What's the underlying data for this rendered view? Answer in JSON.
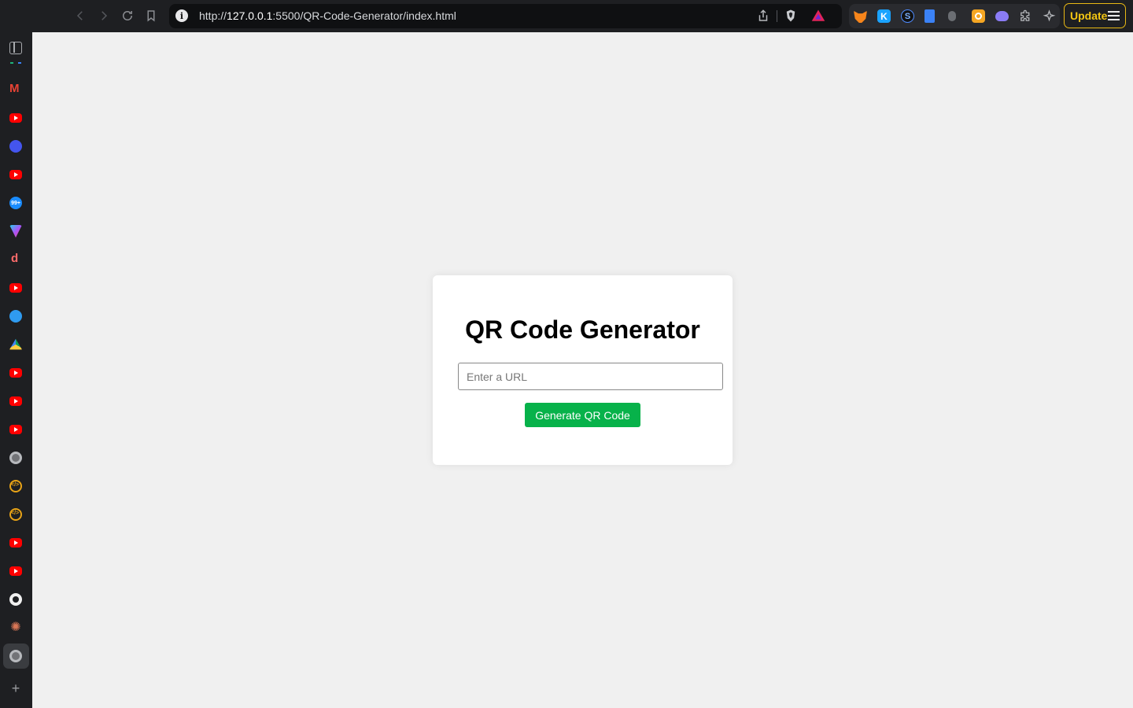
{
  "browser": {
    "url_scheme": "http://",
    "url_host": "127.0.0.1",
    "url_rest": ":5500/QR-Code-Generator/index.html",
    "update_label": "Update",
    "extensions": [
      "metamask-icon",
      "k-extension-icon",
      "s-extension-icon",
      "document-extension-icon",
      "bug-extension-icon",
      "box-extension-icon",
      "game-extension-icon",
      "puzzle-icon",
      "sparkle-icon"
    ],
    "accent_color": "#f3c613"
  },
  "sidebar": {
    "items": [
      "sidebar-panel-icon",
      "gmail-icon",
      "youtube-icon",
      "blue-app-icon",
      "youtube-icon",
      "notifications-99-icon",
      "triangle-app-icon",
      "dj-app-icon",
      "youtube-icon",
      "blue-circle-icon",
      "google-drive-icon",
      "youtube-icon",
      "youtube-icon",
      "youtube-icon",
      "globe-icon",
      "code-icon",
      "code-icon",
      "youtube-icon",
      "youtube-icon",
      "github-icon",
      "claude-icon",
      "globe-icon"
    ],
    "badge_99": "99+",
    "plus": "+"
  },
  "page": {
    "title": "QR Code Generator",
    "input_placeholder": "Enter a URL",
    "input_value": "",
    "button_label": "Generate QR Code",
    "button_color": "#07b24a",
    "background_color": "#f0f0f0"
  }
}
